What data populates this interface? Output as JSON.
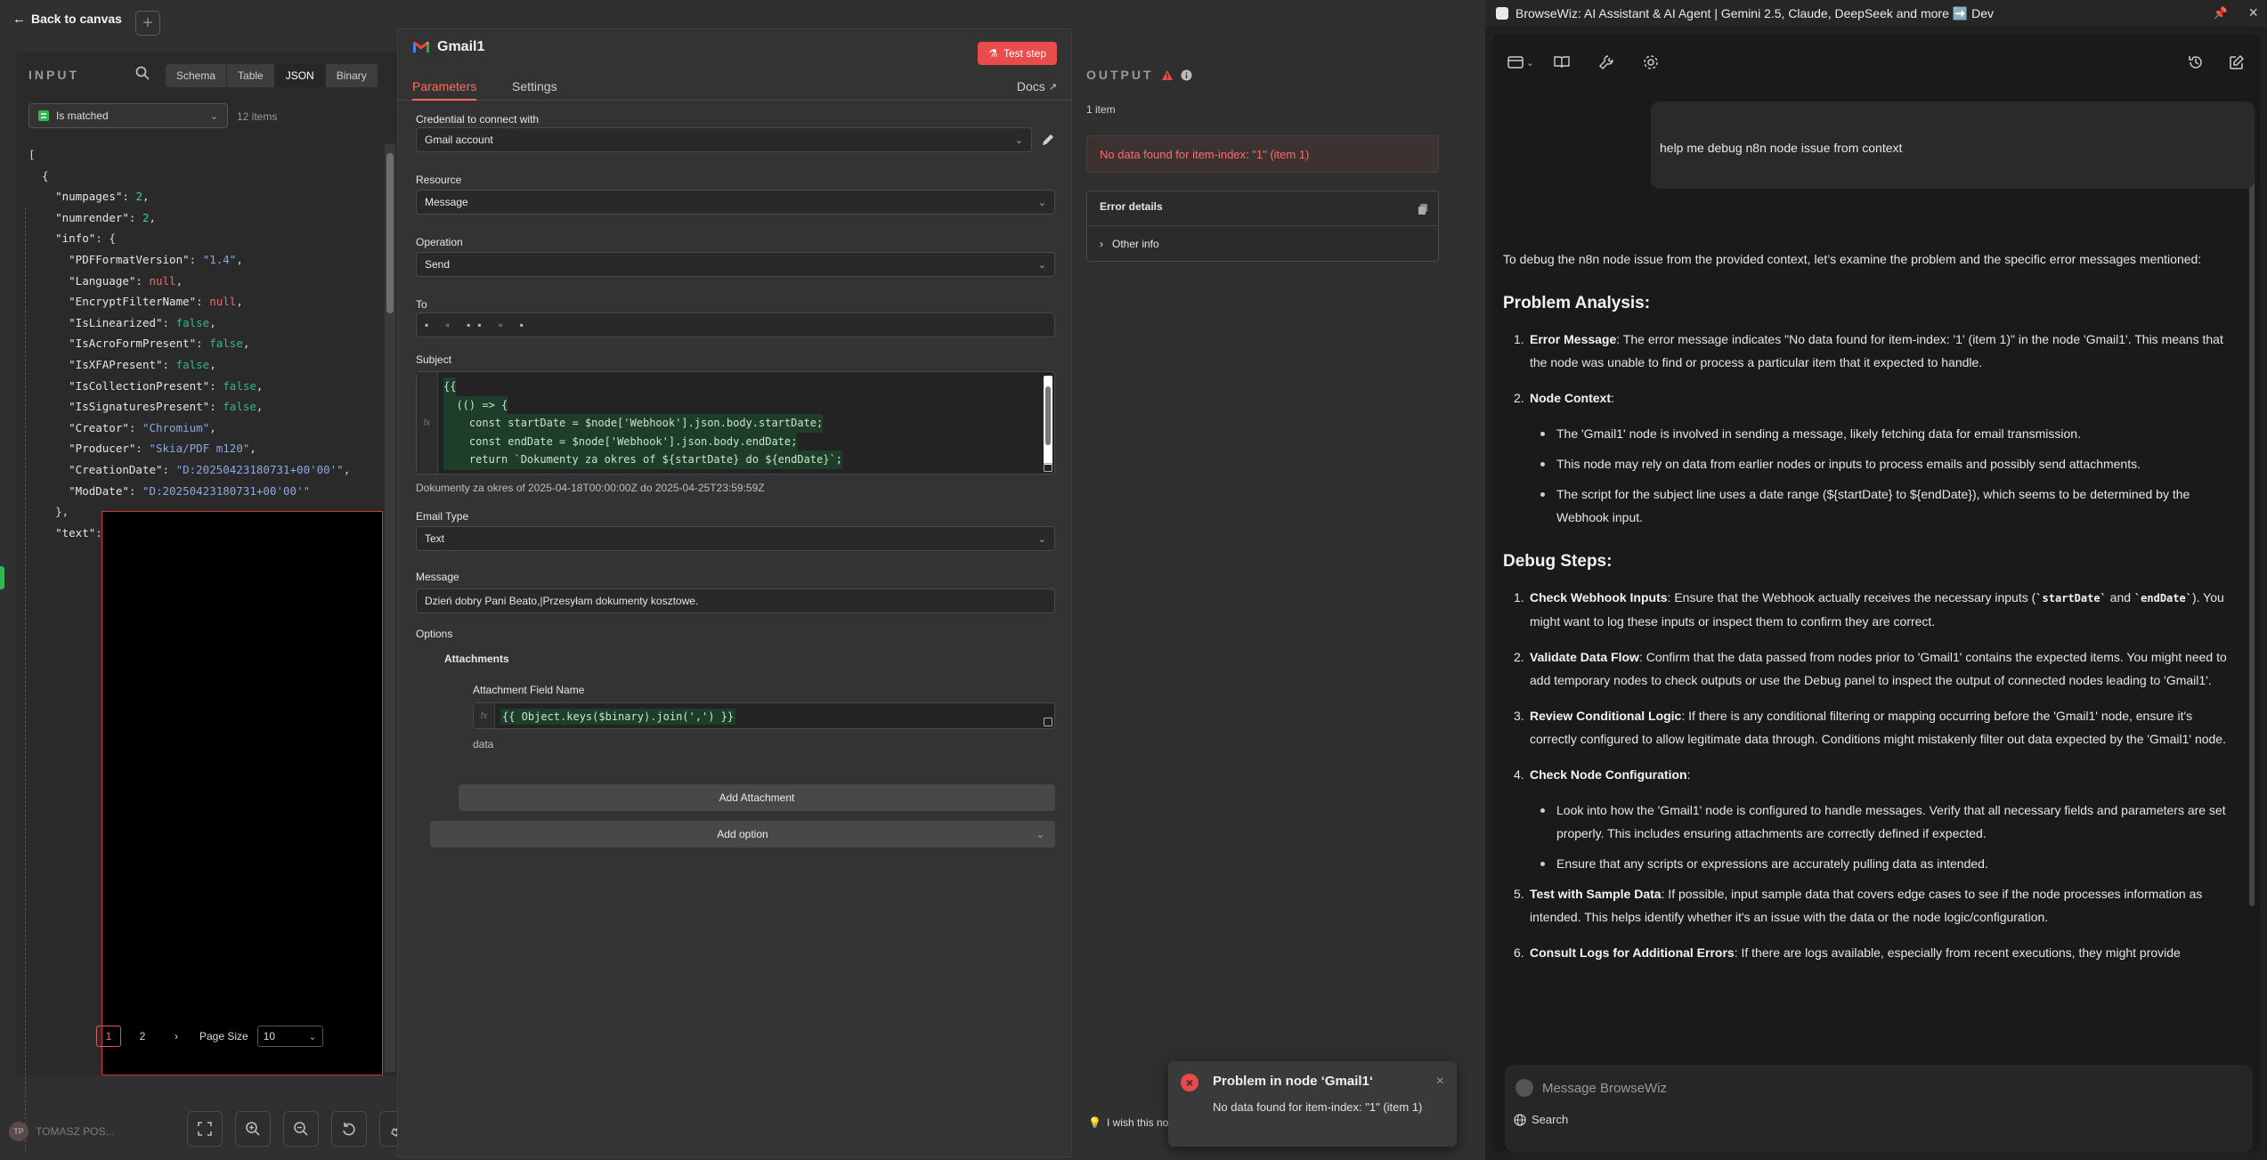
{
  "canvas": {
    "back_label": "Back to canvas",
    "plus_label": "+"
  },
  "input": {
    "title": "INPUT",
    "views": [
      "Schema",
      "Table",
      "JSON",
      "Binary"
    ],
    "active_view": "JSON",
    "filter": "Is matched",
    "items_count": "12 items",
    "json_lines": [
      [
        [
          "p",
          "["
        ]
      ],
      [
        [
          "p",
          "  {"
        ]
      ],
      [
        [
          "p",
          "    "
        ],
        [
          "k",
          "\"numpages\""
        ],
        [
          "p",
          ": "
        ],
        [
          "n",
          "2"
        ],
        [
          "p",
          ","
        ]
      ],
      [
        [
          "p",
          "    "
        ],
        [
          "k",
          "\"numrender\""
        ],
        [
          "p",
          ": "
        ],
        [
          "n",
          "2"
        ],
        [
          "p",
          ","
        ]
      ],
      [
        [
          "p",
          "    "
        ],
        [
          "k",
          "\"info\""
        ],
        [
          "p",
          ": {"
        ]
      ],
      [
        [
          "p",
          "      "
        ],
        [
          "k",
          "\"PDFFormatVersion\""
        ],
        [
          "p",
          ": "
        ],
        [
          "s",
          "\"1.4\""
        ],
        [
          "p",
          ","
        ]
      ],
      [
        [
          "p",
          "      "
        ],
        [
          "k",
          "\"Language\""
        ],
        [
          "p",
          ": "
        ],
        [
          "x",
          "null"
        ],
        [
          "p",
          ","
        ]
      ],
      [
        [
          "p",
          "      "
        ],
        [
          "k",
          "\"EncryptFilterName\""
        ],
        [
          "p",
          ": "
        ],
        [
          "x",
          "null"
        ],
        [
          "p",
          ","
        ]
      ],
      [
        [
          "p",
          "      "
        ],
        [
          "k",
          "\"IsLinearized\""
        ],
        [
          "p",
          ": "
        ],
        [
          "b",
          "false"
        ],
        [
          "p",
          ","
        ]
      ],
      [
        [
          "p",
          "      "
        ],
        [
          "k",
          "\"IsAcroFormPresent\""
        ],
        [
          "p",
          ": "
        ],
        [
          "b",
          "false"
        ],
        [
          "p",
          ","
        ]
      ],
      [
        [
          "p",
          "      "
        ],
        [
          "k",
          "\"IsXFAPresent\""
        ],
        [
          "p",
          ": "
        ],
        [
          "b",
          "false"
        ],
        [
          "p",
          ","
        ]
      ],
      [
        [
          "p",
          "      "
        ],
        [
          "k",
          "\"IsCollectionPresent\""
        ],
        [
          "p",
          ": "
        ],
        [
          "b",
          "false"
        ],
        [
          "p",
          ","
        ]
      ],
      [
        [
          "p",
          "      "
        ],
        [
          "k",
          "\"IsSignaturesPresent\""
        ],
        [
          "p",
          ": "
        ],
        [
          "b",
          "false"
        ],
        [
          "p",
          ","
        ]
      ],
      [
        [
          "p",
          "      "
        ],
        [
          "k",
          "\"Creator\""
        ],
        [
          "p",
          ": "
        ],
        [
          "s",
          "\"Chromium\""
        ],
        [
          "p",
          ","
        ]
      ],
      [
        [
          "p",
          "      "
        ],
        [
          "k",
          "\"Producer\""
        ],
        [
          "p",
          ": "
        ],
        [
          "s",
          "\"Skia/PDF m120\""
        ],
        [
          "p",
          ","
        ]
      ],
      [
        [
          "p",
          "      "
        ],
        [
          "k",
          "\"CreationDate\""
        ],
        [
          "p",
          ": "
        ],
        [
          "s",
          "\"D:20250423180731+00'00'\""
        ],
        [
          "p",
          ","
        ]
      ],
      [
        [
          "p",
          "      "
        ],
        [
          "k",
          "\"ModDate\""
        ],
        [
          "p",
          ": "
        ],
        [
          "s",
          "\"D:20250423180731+00'00'\""
        ]
      ],
      [
        [
          "p",
          "    },"
        ]
      ],
      [
        [
          "p",
          "    "
        ],
        [
          "k",
          "\"text\""
        ],
        [
          "p",
          ":"
        ]
      ]
    ],
    "pages": [
      "1",
      "2"
    ],
    "active_page": "1",
    "next_icon": "chevron-right-icon",
    "page_size_label": "Page Size",
    "page_size_value": "10"
  },
  "footer": {
    "user_initials": "TP",
    "user_name": "TOMASZ POS..."
  },
  "node": {
    "title": "Gmail1",
    "test_step_label": "Test step",
    "tabs": [
      "Parameters",
      "Settings"
    ],
    "active_tab": "Parameters",
    "docs_label": "Docs",
    "credential_label": "Credential to connect with",
    "credential_value": "Gmail account",
    "resource_label": "Resource",
    "resource_value": "Message",
    "operation_label": "Operation",
    "operation_value": "Send",
    "to_label": "To",
    "subject_label": "Subject",
    "subject_code": [
      "{{",
      "  (() => {",
      "    const startDate = $node['Webhook'].json.body.startDate;",
      "    const endDate = $node['Webhook'].json.body.endDate;",
      "    return `Dokumenty za okres of ${startDate} do ${endDate}`;",
      "  })()"
    ],
    "subject_preview": "Dokumenty za okres of 2025-04-18T00:00:00Z do 2025-04-25T23:59:59Z",
    "email_type_label": "Email Type",
    "email_type_value": "Text",
    "message_label": "Message",
    "message_value": "Dzień dobry Pani Beato,|Przesyłam dokumenty kosztowe.",
    "options_label": "Options",
    "attachments_label": "Attachments",
    "attach_field_label": "Attachment Field Name",
    "attach_code": "{{ Object.keys($binary).join(',') }}",
    "attach_preview": "data",
    "add_attachment_label": "Add Attachment",
    "add_option_label": "Add option"
  },
  "output": {
    "title": "OUTPUT",
    "items": "1 item",
    "error": "No data found for item-index: \"1\" (item 1)",
    "error_details_title": "Error details",
    "other_info": "Other info",
    "wish_text": "I wish this no"
  },
  "toast": {
    "title": "Problem in node ‘Gmail1‘",
    "message": "No data found for item-index: \"1\" (item 1)"
  },
  "browsewiz": {
    "title": "BrowseWiz: AI Assistant & AI Agent | Gemini 2.5, Claude, DeepSeek and more ➡️ Dev",
    "user_message": "help me debug n8n node issue from context",
    "intro": "To debug the n8n node issue from the provided context, let’s examine the problem and the specific error messages mentioned:",
    "h_problem": "Problem Analysis:",
    "p1_title": "Error Message",
    "p1_text": ": The error message indicates \"No data found for item-index: '1' (item 1)\" in the node 'Gmail1'. This means that the node was unable to find or process a particular item that it expected to handle.",
    "p2_title": "Node Context",
    "p2_text": ":",
    "p2_bullets": [
      "The 'Gmail1' node is involved in sending a message, likely fetching data for email transmission.",
      "This node may rely on data from earlier nodes or inputs to process emails and possibly send attachments.",
      "The script for the subject line uses a date range (${startDate} to ${endDate}), which seems to be determined by the Webhook input."
    ],
    "h_debug": "Debug Steps:",
    "d1_title": "Check Webhook Inputs",
    "d1_a": ": Ensure that the Webhook actually receives the necessary inputs (",
    "d1_code1": "`startDate`",
    "d1_b": " and ",
    "d1_code2": "`endDate`",
    "d1_c": "). You might want to log these inputs or inspect them to confirm they are correct.",
    "d2_title": "Validate Data Flow",
    "d2_text": ": Confirm that the data passed from nodes prior to 'Gmail1' contains the expected items. You might need to add temporary nodes to check outputs or use the Debug panel to inspect the output of connected nodes leading to 'Gmail1'.",
    "d3_title": "Review Conditional Logic",
    "d3_text": ": If there is any conditional filtering or mapping occurring before the 'Gmail1' node, ensure it's correctly configured to allow legitimate data through. Conditions might mistakenly filter out data expected by the 'Gmail1' node.",
    "d4_title": "Check Node Configuration",
    "d4_text": ":",
    "d4_bullets": [
      "Look into how the 'Gmail1' node is configured to handle messages. Verify that all necessary fields and parameters are set properly. This includes ensuring attachments are correctly defined if expected.",
      "Ensure that any scripts or expressions are accurately pulling data as intended."
    ],
    "d5_title": "Test with Sample Data",
    "d5_text": ": If possible, input sample data that covers edge cases to see if the node processes information as intended. This helps identify whether it's an issue with the data or the node logic/configuration.",
    "d6_title": "Consult Logs for Additional Errors",
    "d6_text": ": If there are logs available, especially from recent executions, they might provide",
    "input_placeholder": "Message BrowseWiz",
    "search_label": "Search"
  },
  "colors": {
    "accent": "#ff6d5a",
    "error": "#ea4b4b",
    "success": "#2fb889",
    "panel": "#333333"
  }
}
